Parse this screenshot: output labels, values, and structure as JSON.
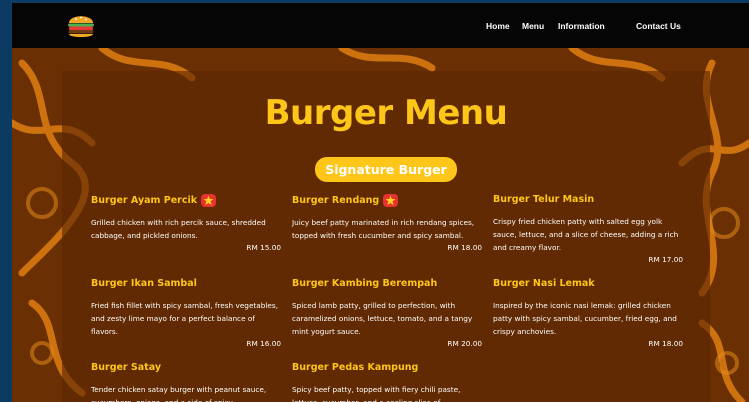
{
  "nav": {
    "logo_icon": "burger-logo-icon",
    "links": [
      "Home",
      "Menu",
      "Information",
      "Contact Us"
    ]
  },
  "page": {
    "title": "Burger Menu",
    "section_badge": "Signature Burger"
  },
  "colors": {
    "accent": "#ffc61a",
    "navbar": "#050505",
    "panel": "#5c2602",
    "badge_red": "#e8322e"
  },
  "menu": [
    {
      "name": "Burger Ayam Percik",
      "star": true,
      "desc": "Grilled chicken with rich percik sauce, shredded cabbage, and pickled onions.",
      "price": "RM 15.00"
    },
    {
      "name": "Burger Rendang",
      "star": true,
      "desc": "Juicy beef patty marinated in rich rendang spices, topped with fresh cucumber and spicy sambal.",
      "price": "RM 18.00"
    },
    {
      "name": "Burger Telur Masin",
      "star": false,
      "desc": "Crispy fried chicken patty with salted egg yolk sauce, lettuce, and a slice of cheese, adding a rich and creamy flavor.",
      "price": "RM 17.00"
    },
    {
      "name": "Burger Ikan Sambal",
      "star": false,
      "desc": "Fried fish fillet with spicy sambal, fresh vegetables, and zesty lime mayo for a perfect balance of flavors.",
      "price": "RM 16.00"
    },
    {
      "name": "Burger Kambing Berempah",
      "star": false,
      "desc": "Spiced lamb patty, grilled to perfection, with caramelized onions, lettuce, tomato, and a tangy mint yogurt sauce.",
      "price": "RM 20.00"
    },
    {
      "name": "Burger Nasi Lemak",
      "star": false,
      "desc": "Inspired by the iconic nasi lemak: grilled chicken patty with spicy sambal, cucumber, fried egg, and crispy anchovies.",
      "price": "RM 18.00"
    },
    {
      "name": "Burger Satay",
      "star": false,
      "desc": "Tender chicken satay burger with peanut sauce, cucumbers, onions, and a side of spicy",
      "price": ""
    },
    {
      "name": "Burger Pedas Kampung",
      "star": false,
      "desc": "Spicy beef patty, topped with fiery chili paste, lettuce, cucumber, and a cooling slice of",
      "price": ""
    }
  ]
}
